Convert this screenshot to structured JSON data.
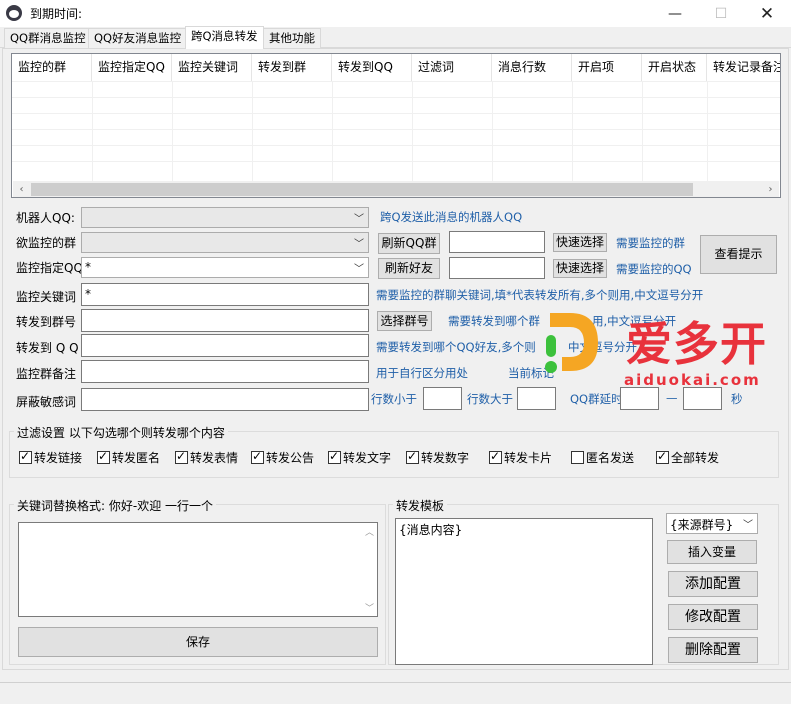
{
  "window": {
    "title": "到期时间:",
    "min_icon": "minimize-icon",
    "max_icon": "maximize-icon",
    "close_icon": "close-icon"
  },
  "tabs": [
    {
      "label": "QQ群消息监控"
    },
    {
      "label": "QQ好友消息监控"
    },
    {
      "label": "跨Q消息转发",
      "active": true
    },
    {
      "label": "其他功能"
    }
  ],
  "list": {
    "columns": [
      "监控的群",
      "监控指定QQ",
      "监控关键词",
      "转发到群",
      "转发到QQ",
      "过滤词",
      "消息行数",
      "开启项",
      "开启状态",
      "转发记录备注"
    ]
  },
  "form": {
    "robot_label": "机器人QQ:",
    "robot_value": "",
    "robot_hint": "跨Q发送此消息的机器人QQ",
    "group_label": "欲监控的群",
    "group_value": "",
    "refresh_group": "刷新QQ群",
    "quick_select1": "快速选择",
    "group_hint": "需要监控的群",
    "view_tips": "查看提示",
    "qq_label": "监控指定QQ",
    "qq_value": "*",
    "refresh_friend": "刷新好友",
    "quick_select2": "快速选择",
    "qq_hint": "需要监控的QQ",
    "keyword_label": "监控关键词",
    "keyword_value": "*",
    "keyword_hint": "需要监控的群聊关键词,填*代表转发所有,多个则用,中文逗号分开",
    "fwd_group_label": "转发到群号",
    "fwd_group_value": "",
    "select_group": "选择群号",
    "fwd_group_hint": "需要转发到哪个群",
    "fwd_group_hint2": "用,中文逗号分开",
    "fwd_qq_label": "转发到 Q Q",
    "fwd_qq_value": "",
    "fwd_qq_hint": "需要转发到哪个QQ好友,多个则",
    "fwd_qq_hint2": "中文逗号分开",
    "note_label": "监控群备注",
    "note_value": "",
    "note_hint": "用于自行区分用处",
    "current_mark": "当前标记",
    "sensitive_label": "屏蔽敏感词",
    "sensitive_value": "",
    "lines_less": "行数小于",
    "lines_less_value": "",
    "lines_more": "行数大于",
    "lines_more_value": "",
    "delay_label": "QQ群延时",
    "delay_from": "",
    "dash": "—",
    "delay_to": "",
    "seconds": "秒"
  },
  "filter": {
    "title": "过滤设置 以下勾选哪个则转发哪个内容",
    "items": [
      {
        "label": "转发链接",
        "checked": true
      },
      {
        "label": "转发匿名",
        "checked": true
      },
      {
        "label": "转发表情",
        "checked": true
      },
      {
        "label": "转发公告",
        "checked": true
      },
      {
        "label": "转发文字",
        "checked": true
      },
      {
        "label": "转发数字",
        "checked": true
      },
      {
        "label": "转发卡片",
        "checked": true
      },
      {
        "label": "匿名发送",
        "checked": false
      },
      {
        "label": "全部转发",
        "checked": true
      }
    ]
  },
  "replace": {
    "title": "关键词替换格式: 你好-欢迎 一行一个",
    "content": "",
    "save": "保存"
  },
  "template": {
    "title": "转发模板",
    "content": "{消息内容}",
    "var_select": "{来源群号}",
    "insert_var": "插入变量",
    "add_config": "添加配置",
    "edit_config": "修改配置",
    "delete_config": "删除配置"
  },
  "watermark": {
    "brand": "爱多开",
    "url": "aiduokai.com",
    "primary_color": "#e8323c",
    "accent_color": "#f5a623",
    "green_color": "#3cc13c"
  }
}
